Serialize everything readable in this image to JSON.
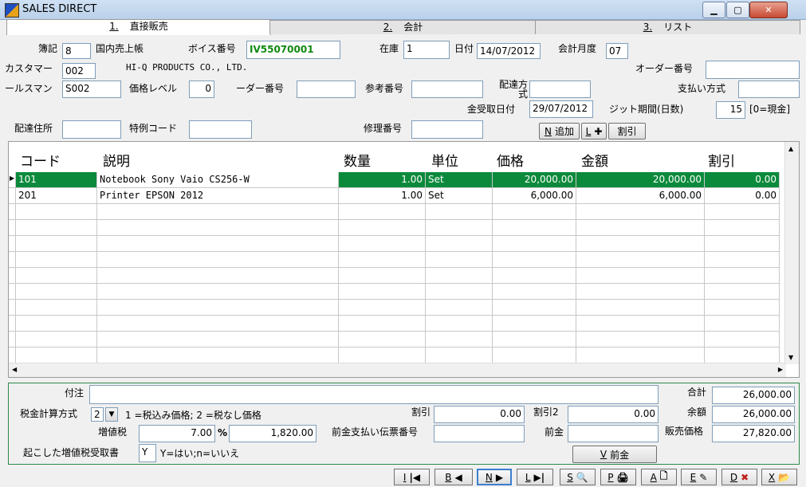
{
  "window": {
    "title": "SALES DIRECT"
  },
  "tabs": [
    {
      "key": "1.",
      "label": "直接販売"
    },
    {
      "key": "2.",
      "label": "会計"
    },
    {
      "key": "3.",
      "label": "リスト"
    }
  ],
  "header": {
    "book_label": "簿記",
    "book_value": "8",
    "book_name": "国内売上帳",
    "invoice_label": "ボイス番号",
    "invoice_value": "IV55070001",
    "stock_label": "在庫",
    "stock_value": "1",
    "date_label": "日付",
    "date_value": "14/07/2012",
    "month_label": "会計月度",
    "month_value": "07",
    "customer_label": "カスタマー",
    "customer_value": "002",
    "customer_name": "HI-Q PRODUCTS CO., LTD.",
    "order_label": "オーダー番号",
    "order_value": "",
    "salesman_label": "ールスマン",
    "salesman_value": "S002",
    "price_level_label": "価格レベル",
    "price_level_value": "0",
    "order2_label": "ーダー番号",
    "order2_value": "",
    "ref_label": "参考番号",
    "ref_value": "",
    "delivery_method_label": "配達方式",
    "delivery_method_value": "",
    "payment_label": "支払い方式",
    "payment_value": "",
    "receipt_date_label": "金受取日付",
    "receipt_date_value": "29/07/2012",
    "credit_label": "ジット期間(日数)",
    "credit_value": "15",
    "credit_note": "[0=現金]",
    "address_label": "配達住所",
    "address_value": "",
    "special_label": "特例コード",
    "special_value": "",
    "repair_label": "修理番号",
    "repair_value": ""
  },
  "actions": {
    "add_key": "N",
    "add_label": "追加",
    "l_key": "L",
    "l_label": "✚",
    "discount_label": "割引"
  },
  "grid": {
    "columns": [
      "コード",
      "説明",
      "数量",
      "単位",
      "価格",
      "金額",
      "割引"
    ],
    "rows": [
      {
        "code": "101",
        "desc": "Notebook Sony Vaio CS256-W",
        "qty": "1.00",
        "unit": "Set",
        "price": "20,000.00",
        "amount": "20,000.00",
        "disc": "0.00"
      },
      {
        "code": "201",
        "desc": "Printer EPSON 2012",
        "qty": "1.00",
        "unit": "Set",
        "price": "6,000.00",
        "amount": "6,000.00",
        "disc": "0.00"
      }
    ]
  },
  "footer": {
    "note_label": "付注",
    "note_value": "",
    "tax_method_label": "税金計算方式",
    "tax_method_value": "2",
    "tax_method_hint": "1 =税込み価格; 2 =税なし価格",
    "vat_label": "増値税",
    "vat_rate": "7.00",
    "vat_pct": "%",
    "vat_amount": "1,820.00",
    "vat_receipt_label": "起こした増値税受取書",
    "vat_receipt_value": "Y",
    "vat_receipt_hint": "Y=はい;n=いいえ",
    "discount_label": "割引",
    "discount_value": "0.00",
    "discount2_label": "割引2",
    "discount2_value": "0.00",
    "prepay_no_label": "前金支払い伝票番号",
    "prepay_no_value": "",
    "prepay_label": "前金",
    "prepay_value": "",
    "prepay_btn_key": "V",
    "prepay_btn_label": "前金",
    "total_label": "合計",
    "total_value": "26,000.00",
    "balance_label": "余額",
    "balance_value": "26,000.00",
    "sale_price_label": "販売価格",
    "sale_price_value": "27,820.00"
  },
  "nav": [
    {
      "key": "I",
      "glyph": "|◀"
    },
    {
      "key": "B",
      "glyph": "◀"
    },
    {
      "key": "N",
      "glyph": "▶"
    },
    {
      "key": "L",
      "glyph": "▶|"
    },
    {
      "key": "S",
      "glyph": "🔍"
    },
    {
      "key": "P",
      "glyph": "🖨"
    },
    {
      "key": "A",
      "glyph": "🗋"
    },
    {
      "key": "E",
      "glyph": "✎"
    },
    {
      "key": "D",
      "glyph": "✖"
    },
    {
      "key": "X",
      "glyph": "📂"
    }
  ]
}
